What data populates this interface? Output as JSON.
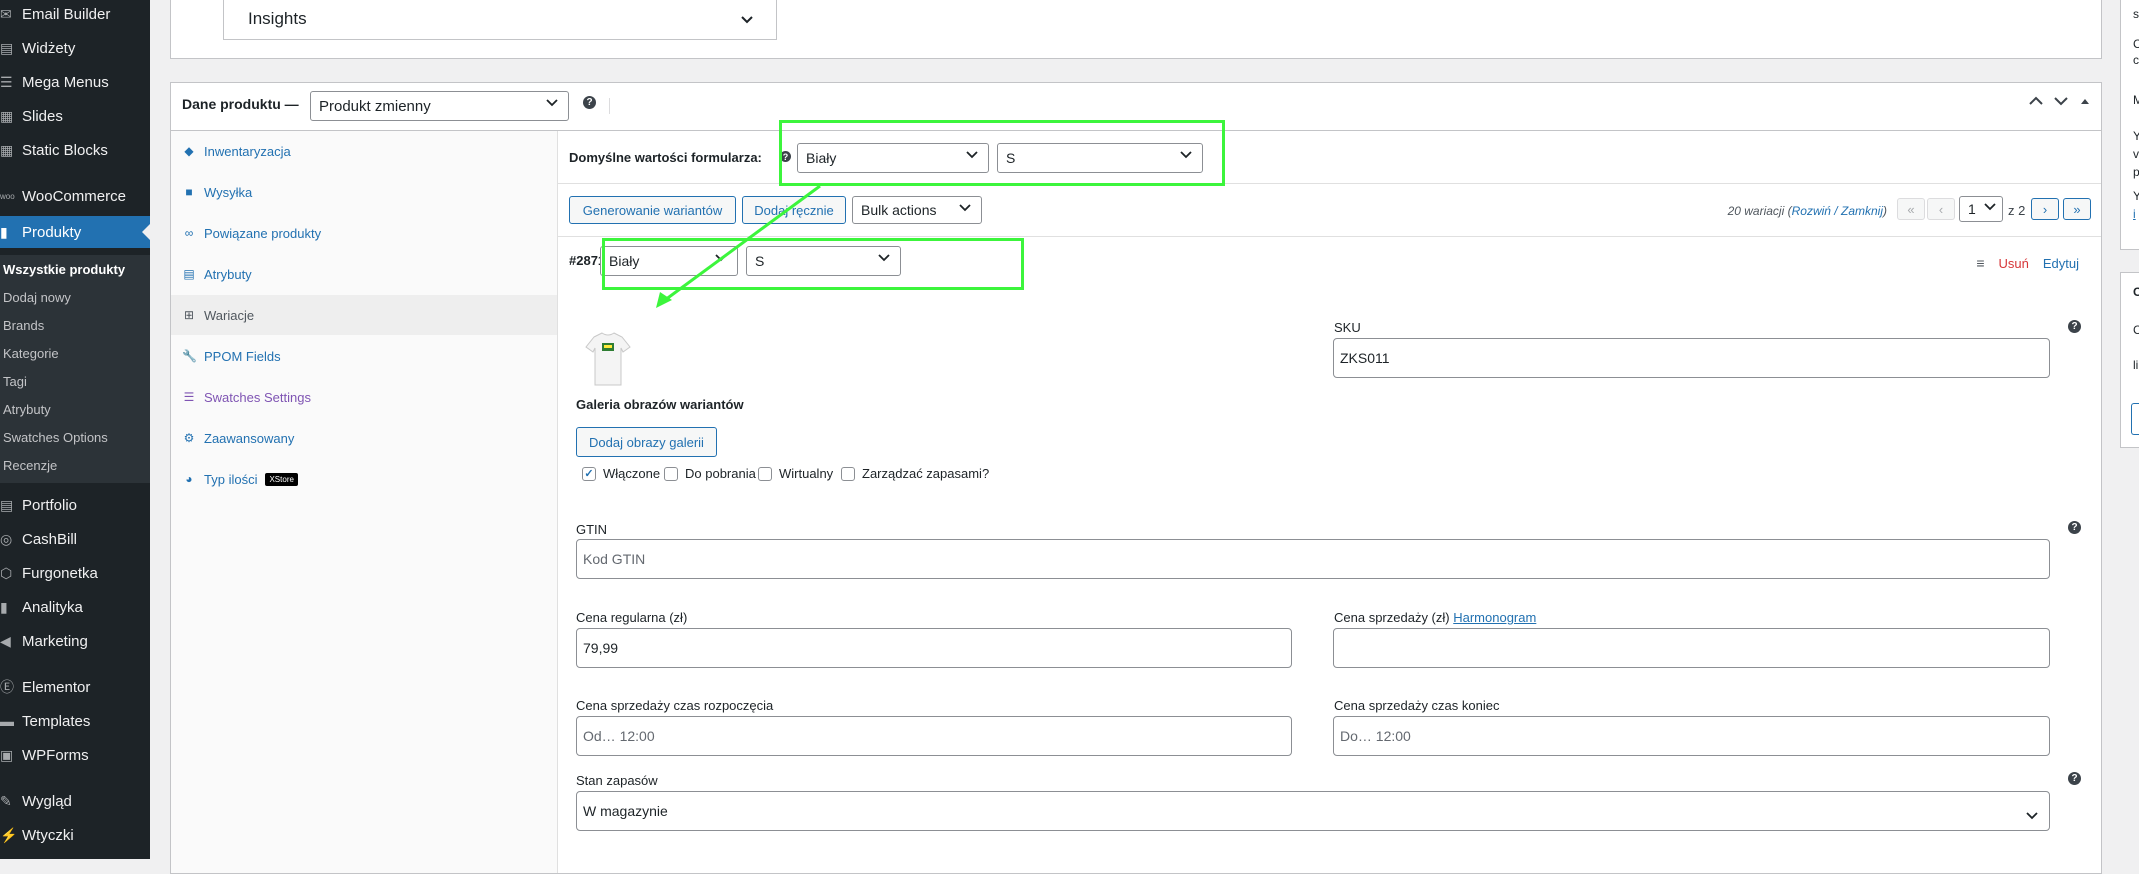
{
  "sidebar": {
    "menu": [
      {
        "label": "Email Builder",
        "icon": "envelope-icon"
      },
      {
        "label": "Widżety",
        "icon": "widgets-icon"
      },
      {
        "label": "Mega Menus",
        "icon": "mega-menu-icon"
      },
      {
        "label": "Slides",
        "icon": "slides-icon"
      },
      {
        "label": "Static Blocks",
        "icon": "blocks-icon"
      },
      {
        "label": "WooCommerce",
        "icon": "woo-icon"
      },
      {
        "label": "Produkty",
        "icon": "products-icon"
      },
      {
        "label": "Portfolio",
        "icon": "portfolio-icon"
      },
      {
        "label": "CashBill",
        "icon": "cashbill-icon"
      },
      {
        "label": "Furgonetka",
        "icon": "box-icon"
      },
      {
        "label": "Analityka",
        "icon": "analytics-icon"
      },
      {
        "label": "Marketing",
        "icon": "megaphone-icon"
      },
      {
        "label": "Elementor",
        "icon": "elementor-icon"
      },
      {
        "label": "Templates",
        "icon": "templates-icon"
      },
      {
        "label": "WPForms",
        "icon": "forms-icon"
      },
      {
        "label": "Wygląd",
        "icon": "brush-icon"
      },
      {
        "label": "Wtyczki",
        "icon": "plugin-icon"
      }
    ],
    "submenu": [
      "Wszystkie produkty",
      "Dodaj nowy",
      "Brands",
      "Kategorie",
      "Tagi",
      "Atrybuty",
      "Swatches Options",
      "Recenzje"
    ]
  },
  "insights": {
    "label": "Insights"
  },
  "product_data": {
    "title": "Dane produktu —",
    "type_value": "Produkt zmienny",
    "tabs": [
      "Inwentaryzacja",
      "Wysyłka",
      "Powiązane produkty",
      "Atrybuty",
      "Wariacje",
      "PPOM Fields",
      "Swatches Settings",
      "Zaawansowany",
      "Typ ilości"
    ],
    "xstore_badge": "XStore"
  },
  "variations": {
    "defaults_label": "Domyślne wartości formularza:",
    "default_color": "Biały",
    "default_size": "S",
    "generate_btn": "Generowanie wariantów",
    "add_manual_btn": "Dodaj ręcznie",
    "bulk_actions": "Bulk actions",
    "count_text": "20 wariacji",
    "expand": "Rozwiń",
    "slash": " / ",
    "collapse": "Zamknij",
    "page_value": "1",
    "page_of": "z 2",
    "variation": {
      "id": "#2871",
      "color": "Biały",
      "size": "S",
      "delete": "Usuń",
      "edit": "Edytuj",
      "gallery_label": "Galeria obrazów wariantów",
      "add_gallery_btn": "Dodaj obrazy galerii",
      "sku_label": "SKU",
      "sku_value": "ZKS011",
      "checkboxes": [
        {
          "label": "Włączone",
          "checked": true
        },
        {
          "label": "Do pobrania",
          "checked": false
        },
        {
          "label": "Wirtualny",
          "checked": false
        },
        {
          "label": "Zarządzać zapasami?",
          "checked": false
        }
      ],
      "gtin_label": "GTIN",
      "gtin_placeholder": "Kod GTIN",
      "regular_price_label": "Cena regularna (zł)",
      "regular_price_value": "79,99",
      "sale_price_label": "Cena sprzedaży (zł)",
      "schedule_link": "Harmonogram",
      "sale_price_value": "",
      "sale_start_label": "Cena sprzedaży czas rozpoczęcia",
      "sale_start_placeholder": "Od… 12:00",
      "sale_end_label": "Cena sprzedaży czas koniec",
      "sale_end_placeholder": "Do… 12:00",
      "stock_label": "Stan zapasów",
      "stock_value": "W magazynie"
    }
  },
  "right_panel_letters": [
    "s",
    "C",
    "c",
    "M",
    "Y",
    "v",
    "p",
    "Y",
    "i",
    "C",
    "C",
    "li"
  ],
  "colors": {
    "sidebar_bg": "#1d2327",
    "accent": "#2271b1",
    "annotation": "#3cf53c",
    "delete_red": "#d63638",
    "swatch_purple": "#7f54b3"
  }
}
